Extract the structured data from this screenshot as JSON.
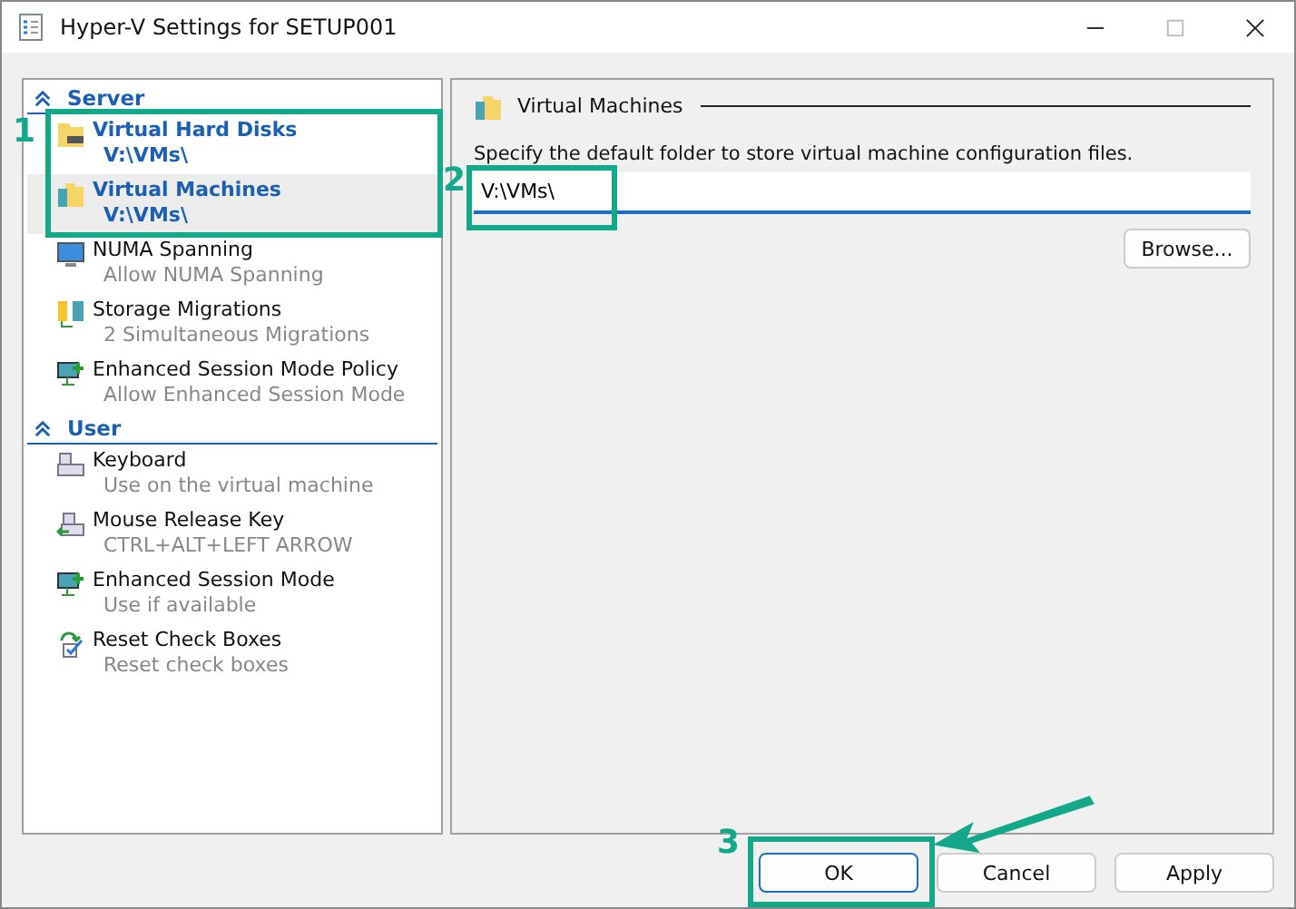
{
  "window": {
    "title": "Hyper-V Settings for SETUP001"
  },
  "tree": [
    {
      "section": "Server",
      "expanded": true,
      "items": [
        {
          "name": "Virtual Hard Disks",
          "value": "V:\\VMs\\",
          "highlighted": true,
          "selected": false
        },
        {
          "name": "Virtual Machines",
          "value": "V:\\VMs\\",
          "highlighted": true,
          "selected": true
        },
        {
          "name": "NUMA Spanning",
          "value": "Allow NUMA Spanning",
          "highlighted": false,
          "selected": false
        },
        {
          "name": "Storage Migrations",
          "value": "2 Simultaneous Migrations",
          "highlighted": false,
          "selected": false
        },
        {
          "name": "Enhanced Session Mode Policy",
          "value": "Allow Enhanced Session Mode",
          "highlighted": false,
          "selected": false
        }
      ]
    },
    {
      "section": "User",
      "expanded": true,
      "items": [
        {
          "name": "Keyboard",
          "value": "Use on the virtual machine",
          "highlighted": false,
          "selected": false
        },
        {
          "name": "Mouse Release Key",
          "value": "CTRL+ALT+LEFT ARROW",
          "highlighted": false,
          "selected": false
        },
        {
          "name": "Enhanced Session Mode",
          "value": "Use if available",
          "highlighted": false,
          "selected": false
        },
        {
          "name": "Reset Check Boxes",
          "value": "Reset check boxes",
          "highlighted": false,
          "selected": false
        }
      ]
    }
  ],
  "panel": {
    "heading": "Virtual Machines",
    "description": "Specify the default folder to store virtual machine configuration files.",
    "folder_value": "V:\\VMs\\",
    "browse_button": "Browse..."
  },
  "buttons": [
    {
      "label": "OK",
      "default": true
    },
    {
      "label": "Cancel",
      "default": false
    },
    {
      "label": "Apply",
      "default": false
    }
  ],
  "annotations": [
    {
      "label": "1"
    },
    {
      "label": "2"
    },
    {
      "label": "3"
    }
  ]
}
